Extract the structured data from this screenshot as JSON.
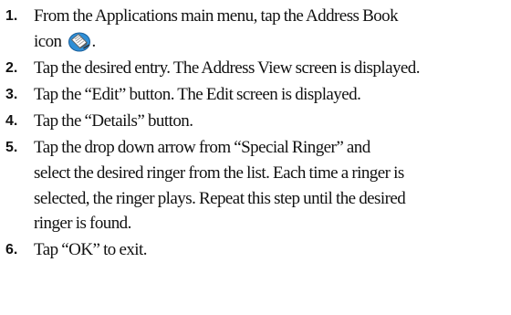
{
  "steps": [
    {
      "number": "1.",
      "line1": "From the Applications main menu, tap the Address Book",
      "line2_before_icon": "icon",
      "icon": "address-book-icon",
      "line2_after_icon": "."
    },
    {
      "number": "2.",
      "lines": [
        "Tap the desired entry. The Address View screen is displayed."
      ]
    },
    {
      "number": "3.",
      "lines": [
        "Tap the “Edit” button. The Edit screen is displayed."
      ]
    },
    {
      "number": "4.",
      "lines": [
        "Tap the “Details” button."
      ]
    },
    {
      "number": "5.",
      "lines": [
        "Tap the drop down arrow from “Special Ringer” and",
        "select the desired ringer from the list. Each time a ringer is",
        "selected, the ringer plays. Repeat this step until the desired",
        "ringer is found."
      ]
    },
    {
      "number": "6.",
      "lines": [
        "Tap “OK” to exit."
      ]
    }
  ]
}
